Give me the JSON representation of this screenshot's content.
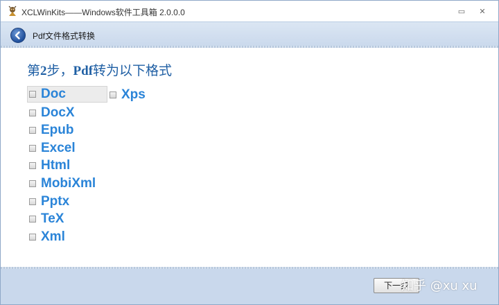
{
  "window": {
    "title": "XCLWinKits——Windows软件工具箱 2.0.0.0",
    "minimize_glyph": "▭",
    "close_glyph": "✕",
    "icon": "app-logo-icon"
  },
  "nav": {
    "title": "Pdf文件格式转换",
    "back_icon": "back-arrow-icon"
  },
  "content": {
    "heading_prefix": "第",
    "heading_num": "2",
    "heading_mid": "步，",
    "heading_bold": "Pdf",
    "heading_suffix": "转为以下格式",
    "options": [
      {
        "label": "Doc",
        "checked": false,
        "focused": true
      },
      {
        "label": "Xps",
        "checked": false,
        "focused": false
      },
      {
        "label": "DocX",
        "checked": false,
        "focused": false
      },
      {
        "label": "Epub",
        "checked": false,
        "focused": false
      },
      {
        "label": "Excel",
        "checked": false,
        "focused": false
      },
      {
        "label": "Html",
        "checked": false,
        "focused": false
      },
      {
        "label": "MobiXml",
        "checked": false,
        "focused": false
      },
      {
        "label": "Pptx",
        "checked": false,
        "focused": false
      },
      {
        "label": "TeX",
        "checked": false,
        "focused": false
      },
      {
        "label": "Xml",
        "checked": false,
        "focused": false
      }
    ]
  },
  "footer": {
    "next_label": "下一步",
    "watermark": "知乎 @xu xu"
  },
  "colors": {
    "accent": "#2a84d8",
    "heading": "#1f5fa4",
    "bar": "#c9d8ec"
  }
}
